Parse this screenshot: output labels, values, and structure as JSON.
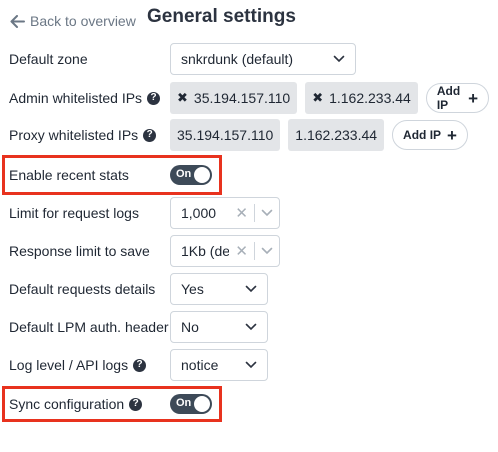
{
  "header": {
    "back_label": "Back to overview",
    "title": "General settings"
  },
  "colors": {
    "highlight": "#e8321e",
    "toggle_on": "#3d4a58",
    "chip_bg": "#e3e5e8"
  },
  "settings": {
    "default_zone": {
      "label": "Default zone",
      "value": "snkrdunk (default)"
    },
    "admin_ips": {
      "label": "Admin whitelisted IPs",
      "chips": [
        "35.194.157.110",
        "1.162.233.44"
      ],
      "add_label": "Add IP"
    },
    "proxy_ips": {
      "label": "Proxy whitelisted IPs",
      "chips": [
        "35.194.157.110",
        "1.162.233.44"
      ],
      "add_label": "Add IP"
    },
    "recent_stats": {
      "label": "Enable recent stats",
      "toggle": "On"
    },
    "request_logs": {
      "label": "Limit for request logs",
      "value": "1,000",
      "clear": "✕"
    },
    "response_limit": {
      "label": "Response limit to save",
      "value": "1Kb (de...",
      "clear": "✕"
    },
    "requests_details": {
      "label": "Default requests details",
      "value": "Yes"
    },
    "lpm_header": {
      "label": "Default LPM auth. header",
      "value": "No"
    },
    "log_level": {
      "label": "Log level / API logs",
      "value": "notice"
    },
    "sync_config": {
      "label": "Sync configuration",
      "toggle": "On"
    }
  },
  "icons": {
    "help": "?",
    "remove": "✖",
    "plus": "+"
  }
}
